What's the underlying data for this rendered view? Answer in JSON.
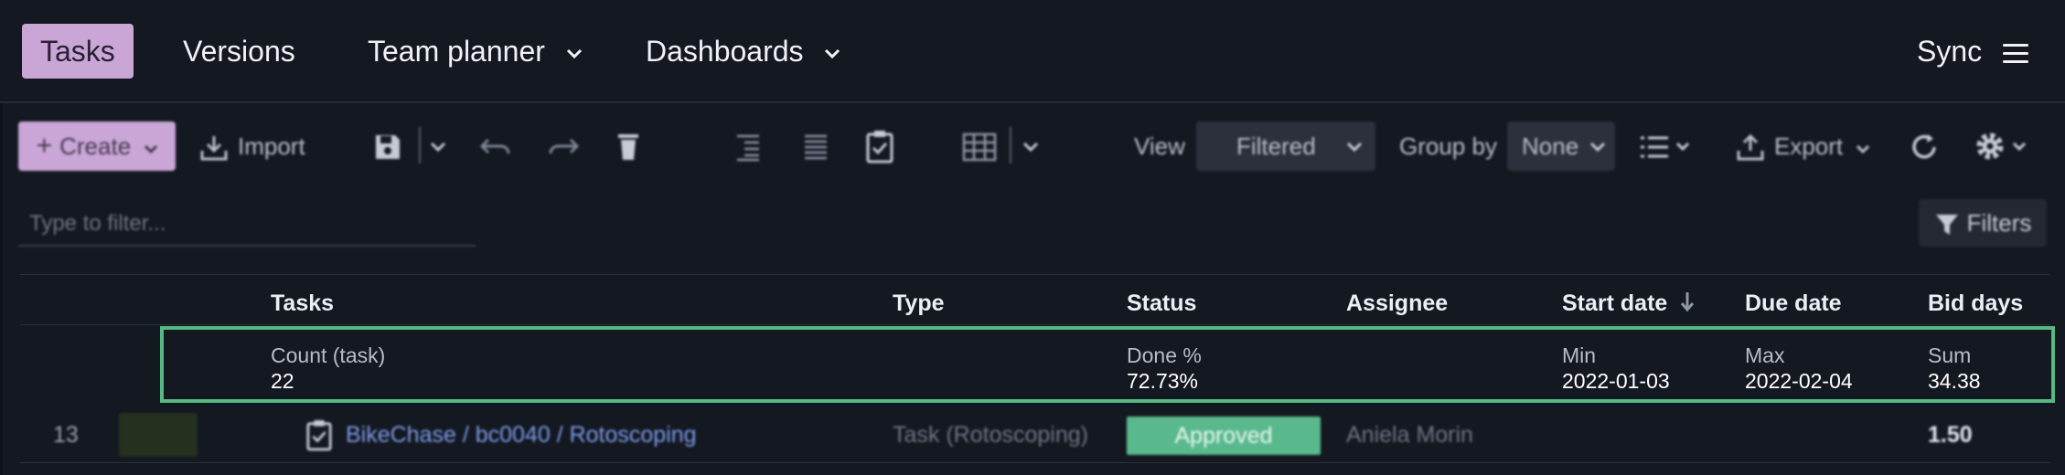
{
  "nav": {
    "tabs": [
      {
        "label": "Tasks",
        "active": true
      },
      {
        "label": "Versions"
      },
      {
        "label": "Team planner",
        "dropdown": true
      },
      {
        "label": "Dashboards",
        "dropdown": true
      }
    ],
    "sync_label": "Sync"
  },
  "toolbar": {
    "create_label": "Create",
    "import_label": "Import",
    "view_label": "View",
    "view_value": "Filtered",
    "group_by_label": "Group by",
    "group_by_value": "None",
    "export_label": "Export"
  },
  "filter": {
    "placeholder": "Type to filter...",
    "filters_label": "Filters"
  },
  "table": {
    "columns": [
      "Tasks",
      "Type",
      "Status",
      "Assignee",
      "Start date",
      "Due date",
      "Bid days"
    ],
    "summary": {
      "tasks_label": "Count (task)",
      "tasks_value": "22",
      "status_label": "Done %",
      "status_value": "72.73%",
      "start_label": "Min",
      "start_value": "2022-01-03",
      "due_label": "Max",
      "due_value": "2022-02-04",
      "bid_label": "Sum",
      "bid_value": "34.38"
    },
    "rows": [
      {
        "id": "13",
        "task": "BikeChase / bc0040 / Rotoscoping",
        "type": "Task (Rotoscoping)",
        "status": "Approved",
        "assignee": "Aniela Morin",
        "bid_days": "1.50"
      }
    ]
  },
  "colors": {
    "background": "#141821",
    "accent": "#c9a6d6",
    "highlight_border": "#57b883",
    "status_approved": "#59b98d"
  }
}
